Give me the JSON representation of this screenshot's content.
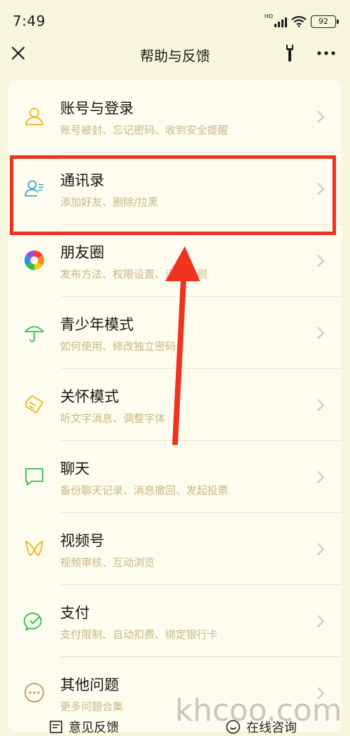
{
  "status_bar": {
    "time": "7:49",
    "network": "HD",
    "battery": "92"
  },
  "nav": {
    "title": "帮助与反馈",
    "close_icon": "close-icon",
    "wrench_icon": "wrench-icon",
    "more_icon": "more-icon"
  },
  "colors": {
    "background": "#f8f5dd",
    "card": "#fdfcee",
    "subtitle": "#c7b785",
    "highlight": "#f0331f"
  },
  "menu": [
    {
      "title": "账号与登录",
      "subtitle": "账号被封、忘记密码、收到安全提醒",
      "icon": "user-icon"
    },
    {
      "title": "通讯录",
      "subtitle": "添加好友、删除/拉黑",
      "icon": "contacts-icon"
    },
    {
      "title": "朋友圈",
      "subtitle": "发布方法、权限设置、评论规则",
      "icon": "moments-icon"
    },
    {
      "title": "青少年模式",
      "subtitle": "如何使用、修改独立密码",
      "icon": "umbrella-icon"
    },
    {
      "title": "关怀模式",
      "subtitle": "听文字消息、调整字体",
      "icon": "care-icon"
    },
    {
      "title": "聊天",
      "subtitle": "备份聊天记录、消息撤回、发起投票",
      "icon": "chat-icon"
    },
    {
      "title": "视频号",
      "subtitle": "视频审核、互动浏览",
      "icon": "channels-icon"
    },
    {
      "title": "支付",
      "subtitle": "支付限制、自动扣费、绑定银行卡",
      "icon": "payment-icon"
    },
    {
      "title": "其他问题",
      "subtitle": "更多问题合集",
      "icon": "more-questions-icon"
    }
  ],
  "bottom_bar": {
    "feedback_label": "意见反馈",
    "consult_label": "在线咨询"
  },
  "watermark": "khcoo.com"
}
